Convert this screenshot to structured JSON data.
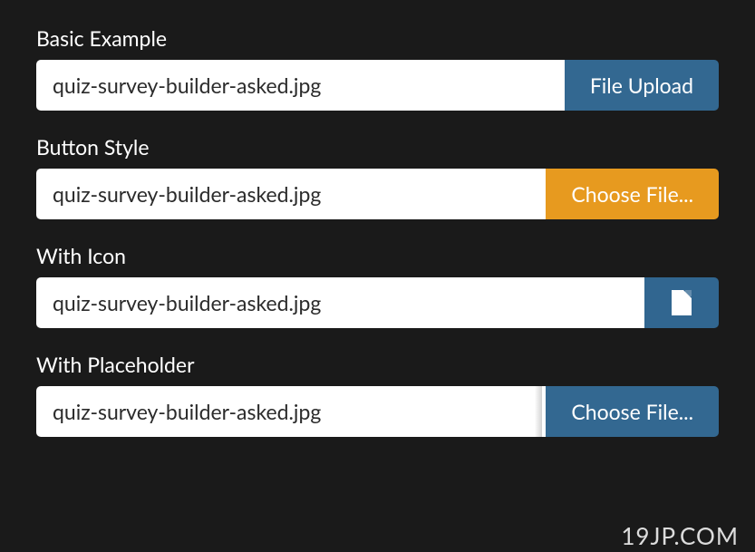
{
  "examples": [
    {
      "label": "Basic Example",
      "filename": "quiz-survey-builder-asked.jpg",
      "button_text": "File Upload"
    },
    {
      "label": "Button Style",
      "filename": "quiz-survey-builder-asked.jpg",
      "button_text": "Choose File..."
    },
    {
      "label": "With Icon",
      "filename": "quiz-survey-builder-asked.jpg"
    },
    {
      "label": "With Placeholder",
      "filename": "quiz-survey-builder-asked.jpg",
      "button_text": "Choose File..."
    }
  ],
  "watermark": "19JP.COM"
}
